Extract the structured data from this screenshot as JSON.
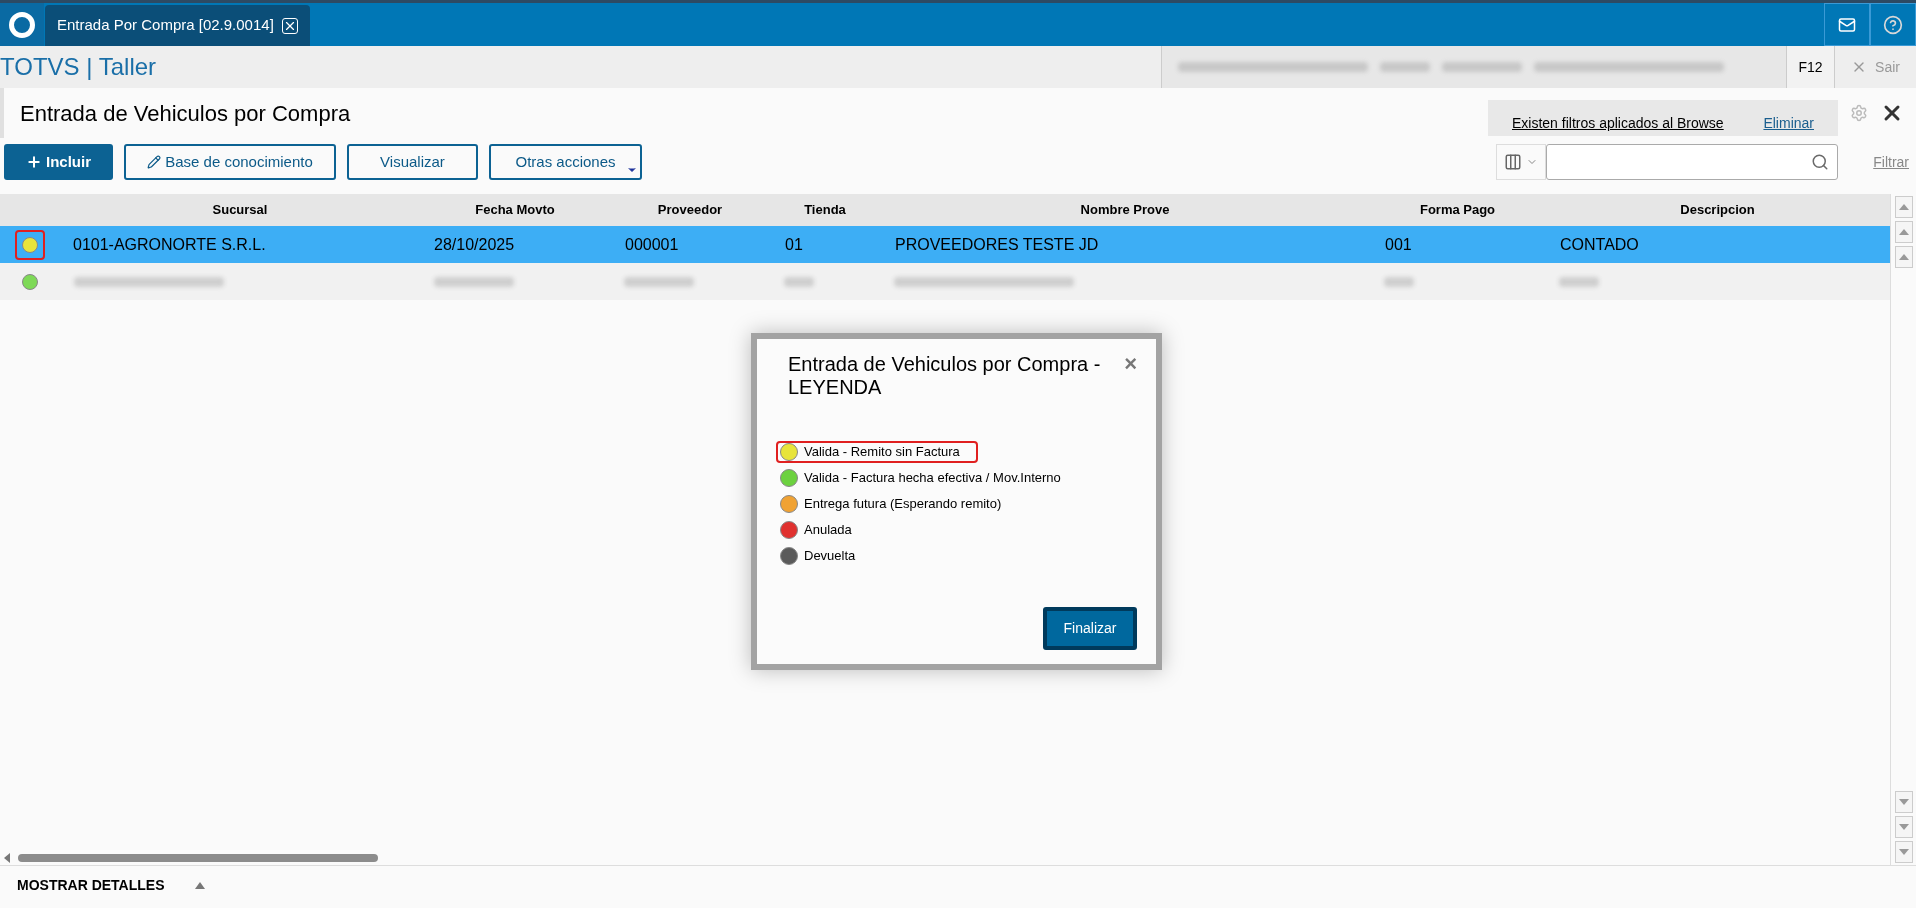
{
  "tab": {
    "label": "Entrada Por Compra [02.9.0014]"
  },
  "app_title": "TOTVS | Taller",
  "session_keys": [
    "F12",
    "Sair"
  ],
  "page_title": "Entrada de Vehiculos por Compra",
  "filter_notice": {
    "text": "Existen filtros aplicados al Browse",
    "action": "Eliminar"
  },
  "actions": [
    {
      "label": "Incluir",
      "kind": "primary"
    },
    {
      "label": "Base de conocimiento",
      "kind": "edit"
    },
    {
      "label": "Visualizar",
      "kind": "plain"
    },
    {
      "label": "Otras acciones",
      "kind": "menu"
    }
  ],
  "filter_link": "Filtrar",
  "table": {
    "columns": [
      "Sucursal",
      "Fecha Movto",
      "Proveedor",
      "Tienda",
      "Nombre Prove",
      "Forma Pago",
      "Descripcion"
    ],
    "rows": [
      {
        "selected": true,
        "highlighted": true,
        "color": "#e8e43a",
        "cells": [
          "0101-AGRONORTE S.R.L.",
          "28/10/2025",
          "000001",
          "01",
          "PROVEEDORES TESTE JD",
          "001",
          "CONTADO"
        ]
      },
      {
        "selected": false,
        "highlighted": false,
        "color": "#7ed957",
        "blurred": true,
        "cells": []
      }
    ]
  },
  "details_toggle": "MOSTRAR DETALLES",
  "legend_dialog": {
    "title": "Entrada de Vehiculos por Compra - LEYENDA",
    "close": "×",
    "items": [
      {
        "label": "Valida - Remito sin Factura",
        "color": "#e8e43a",
        "highlighted": true
      },
      {
        "label": "Valida - Factura hecha efectiva / Mov.Interno",
        "color": "#6cd13f",
        "highlighted": false
      },
      {
        "label": "Entrega futura (Esperando remito)",
        "color": "#f0a233",
        "highlighted": false
      },
      {
        "label": "Anulada",
        "color": "#e0312f",
        "highlighted": false
      },
      {
        "label": "Devuelta",
        "color": "#5a5a5a",
        "highlighted": false
      }
    ],
    "button": "Finalizar"
  }
}
